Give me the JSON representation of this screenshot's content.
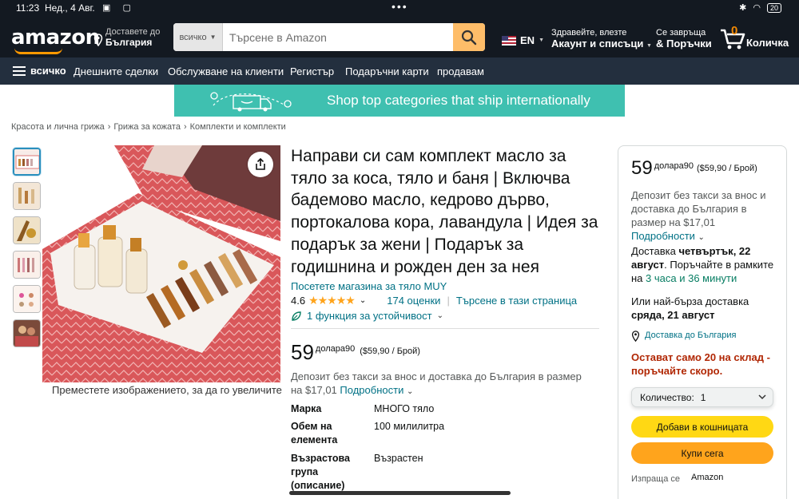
{
  "status_bar": {
    "time": "11:23",
    "date": "Нед., 4 Авг.",
    "battery": "20"
  },
  "nav": {
    "logo": "amazon",
    "deliver_line1": "Доставете до",
    "deliver_line2": "България",
    "search_category": "всичко",
    "search_placeholder": "Търсене в Amazon",
    "lang": "EN",
    "account_line1": "Здравейте, влезте",
    "account_line2": "Акаунт и списъци",
    "returns_line1": "Се завръща",
    "returns_line2": "& Поръчки",
    "cart_count": "0",
    "cart_label": "Количка"
  },
  "subnav": {
    "all": "всичко",
    "items": [
      "Днешните сделки",
      "Обслужване на клиенти",
      "Регистър",
      "Подаръчни карти",
      "продавам"
    ]
  },
  "banner": {
    "text": "Shop top categories that ship internationally"
  },
  "breadcrumb": [
    "Красота и лична грижа",
    "Грижа за кожата",
    "Комплекти и комплекти"
  ],
  "gallery": {
    "zoom_hint": "Преместете изображението, за да го увеличите"
  },
  "product": {
    "title": "Направи си сам комплект масло за тяло за коса, тяло и баня | Включва бадемово масло, кедрово дърво, портокалова кора, лавандула | Идея за подарък за жени | Подарък за годишнина и рожден ден за нея",
    "store_link": "Посетете магазина за тяло MUY",
    "rating": "4.6",
    "ratings_count": "174 оценки",
    "search_page": "Търсене в тази страница",
    "sustainability": "1 функция за устойчивост",
    "price_whole": "59",
    "price_fraction": "долара90",
    "price_unit": "($59,90 / Брой)",
    "deposit_text": "Депозит без такси за внос и доставка до България в размер на $17,01",
    "details_link": "Подробности",
    "specs": [
      {
        "key": "Марка",
        "value": "МНОГО тяло"
      },
      {
        "key": "Обем на елемента",
        "value": "100 милилитра"
      },
      {
        "key": "Възрастова група (описание)",
        "value": "Възрастен"
      }
    ]
  },
  "buybox": {
    "price_whole": "59",
    "price_fraction": "долара90",
    "price_unit": "($59,90 / Брой)",
    "deposit_text": "Депозит без такси за внос и доставка до България в размер на $17,01",
    "details_link": "Подробности",
    "delivery_prefix": "Доставка",
    "delivery_date": "четвъртък, 22 август",
    "order_within": ". Поръчайте в рамките на",
    "countdown": "3 часа и 36 минути",
    "fast_prefix": "Или най-бърза доставка",
    "fast_date": "сряда, 21 август",
    "deliver_to": "Доставка до  България",
    "stock": "Остават само 20 на склад - поръчайте скоро.",
    "qty_label": "Количество:",
    "qty_value": "1",
    "add_to_cart": "Добави в кошницата",
    "buy_now": "Купи сега",
    "ships_from_label": "Изпраща се",
    "ships_from_value": "Amazon"
  },
  "colors": {
    "nav": "#131921",
    "subnav": "#232f3e",
    "accent": "#febd69",
    "link": "#007185",
    "banner": "#3fc0b0",
    "cart_button": "#ffd814",
    "buy_button": "#ffa41c"
  }
}
